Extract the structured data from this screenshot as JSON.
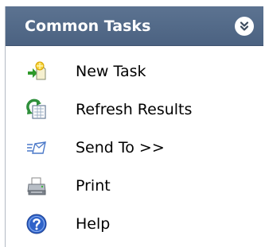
{
  "panel": {
    "title": "Common Tasks",
    "collapse_icon": "double-chevron-up-icon",
    "header_color": "#52698a"
  },
  "tasks": [
    {
      "label": "New Task",
      "icon": "new-task-icon"
    },
    {
      "label": "Refresh Results",
      "icon": "refresh-results-icon"
    },
    {
      "label": "Send To >>",
      "icon": "send-to-icon"
    },
    {
      "label": "Print",
      "icon": "printer-icon"
    },
    {
      "label": "Help",
      "icon": "help-icon"
    }
  ]
}
